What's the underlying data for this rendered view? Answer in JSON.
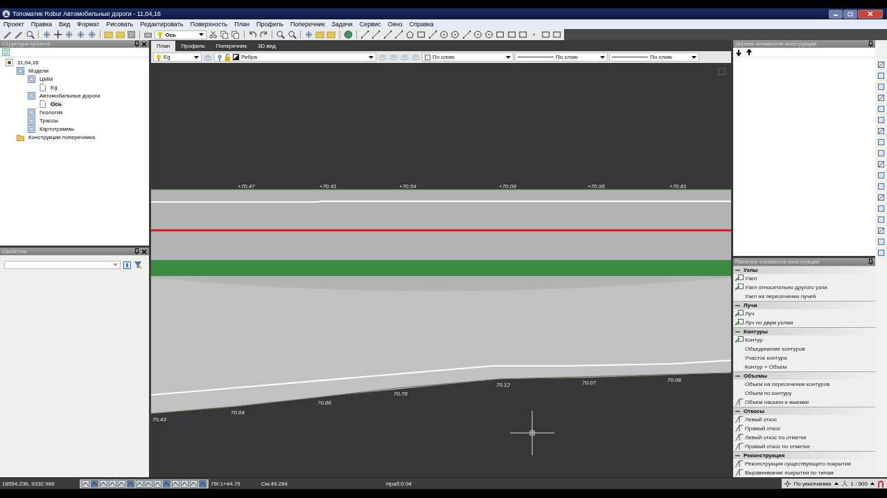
{
  "window": {
    "title": "Топоматик Robur Автомобильные дороги - 11,04,16"
  },
  "menu": [
    "Проект",
    "Правка",
    "Вид",
    "Формат",
    "Рисовать",
    "Редактировать",
    "Поверхность",
    "План",
    "Профиль",
    "Поперечник",
    "Задачи",
    "Сервис",
    "Окно",
    "Справка"
  ],
  "toolbar": {
    "layer_combo": "Ось"
  },
  "project_panel": {
    "title": "Структура проекта",
    "tree": [
      {
        "label": "11,04,16",
        "kind": "project",
        "selected": false,
        "children": [
          {
            "label": "Модели",
            "kind": "group",
            "selected": false,
            "children": [
              {
                "label": "ЦММ",
                "kind": "model",
                "selected": false,
                "children": [
                  {
                    "label": "Eg",
                    "kind": "document",
                    "selected": false
                  }
                ]
              },
              {
                "label": "Автомобильные дороги",
                "kind": "model",
                "selected": false,
                "children": [
                  {
                    "label": "Ось",
                    "kind": "document",
                    "selected": true
                  }
                ]
              },
              {
                "label": "Геология",
                "kind": "model",
                "selected": false
              },
              {
                "label": "Трассы",
                "kind": "model",
                "selected": false
              },
              {
                "label": "Картограммы",
                "kind": "model",
                "selected": false
              }
            ]
          },
          {
            "label": "Конструкции поперечника",
            "kind": "folder",
            "selected": false
          }
        ]
      }
    ]
  },
  "properties_panel": {
    "title": "Свойства"
  },
  "tabs": [
    {
      "label": "План",
      "selected": true
    },
    {
      "label": "Профиль",
      "selected": false
    },
    {
      "label": "Поперечник",
      "selected": false
    },
    {
      "label": "3D вид",
      "selected": false
    }
  ],
  "layer_bar": {
    "surface": "Eg",
    "layer": "Ребра",
    "color_setting": "По слою",
    "linetype": "По слою",
    "lineweight": "По слою"
  },
  "canvas": {
    "top_marks": [
      "+70.47",
      "+70.41",
      "+70.54",
      "+70.09",
      "+70.95",
      "+70.81"
    ],
    "bottom_marks": [
      "70.43",
      "70.64",
      "70.86",
      "70.78",
      "70.12",
      "70.07",
      "70.08"
    ]
  },
  "tree_panel": {
    "title": "Дерево элементов конструкции"
  },
  "palette": {
    "title": "Палитра элементов конструкции",
    "groups": [
      {
        "label": "Узлы",
        "expanded": true,
        "items": [
          {
            "label": "Узел",
            "kind": "node"
          },
          {
            "label": "Узел относительно другого узла",
            "kind": "node"
          },
          {
            "label": "Узел на пересечении лучей",
            "kind": "plain"
          }
        ]
      },
      {
        "label": "Лучи",
        "expanded": true,
        "items": [
          {
            "label": "Луч",
            "kind": "node"
          },
          {
            "label": "Луч по двум узлам",
            "kind": "node"
          }
        ]
      },
      {
        "label": "Контуры",
        "expanded": true,
        "items": [
          {
            "label": "Контур",
            "kind": "node"
          },
          {
            "label": "Объединение контуров",
            "kind": "plain"
          },
          {
            "label": "Участок контура",
            "kind": "plain"
          },
          {
            "label": "Контур + Объем",
            "kind": "plain"
          }
        ]
      },
      {
        "label": "Объемы",
        "expanded": true,
        "items": [
          {
            "label": "Объем на пересечении контуров",
            "kind": "plain"
          },
          {
            "label": "Объем по контуру",
            "kind": "plain"
          },
          {
            "label": "Объем насыпи и выемки",
            "kind": "slope"
          }
        ]
      },
      {
        "label": "Откосы",
        "expanded": true,
        "items": [
          {
            "label": "Левый откос",
            "kind": "slope"
          },
          {
            "label": "Правый откос",
            "kind": "slope"
          },
          {
            "label": "Левый откос по отметке",
            "kind": "slope"
          },
          {
            "label": "Правый откос по отметке",
            "kind": "slope"
          }
        ]
      },
      {
        "label": "Реконструкция",
        "expanded": true,
        "items": [
          {
            "label": "Реконструкция существующего покрытия",
            "kind": "slope"
          },
          {
            "label": "Выравнивание покрытия по типам",
            "kind": "slope"
          }
        ]
      }
    ]
  },
  "status_bar": {
    "coords": "18554.236, 9332.986",
    "station": "ПК:1+44.79",
    "offset": "См:49.284",
    "depth": "Нраб:0.04",
    "style": "По умолчанию",
    "scale": "1 : 500"
  }
}
